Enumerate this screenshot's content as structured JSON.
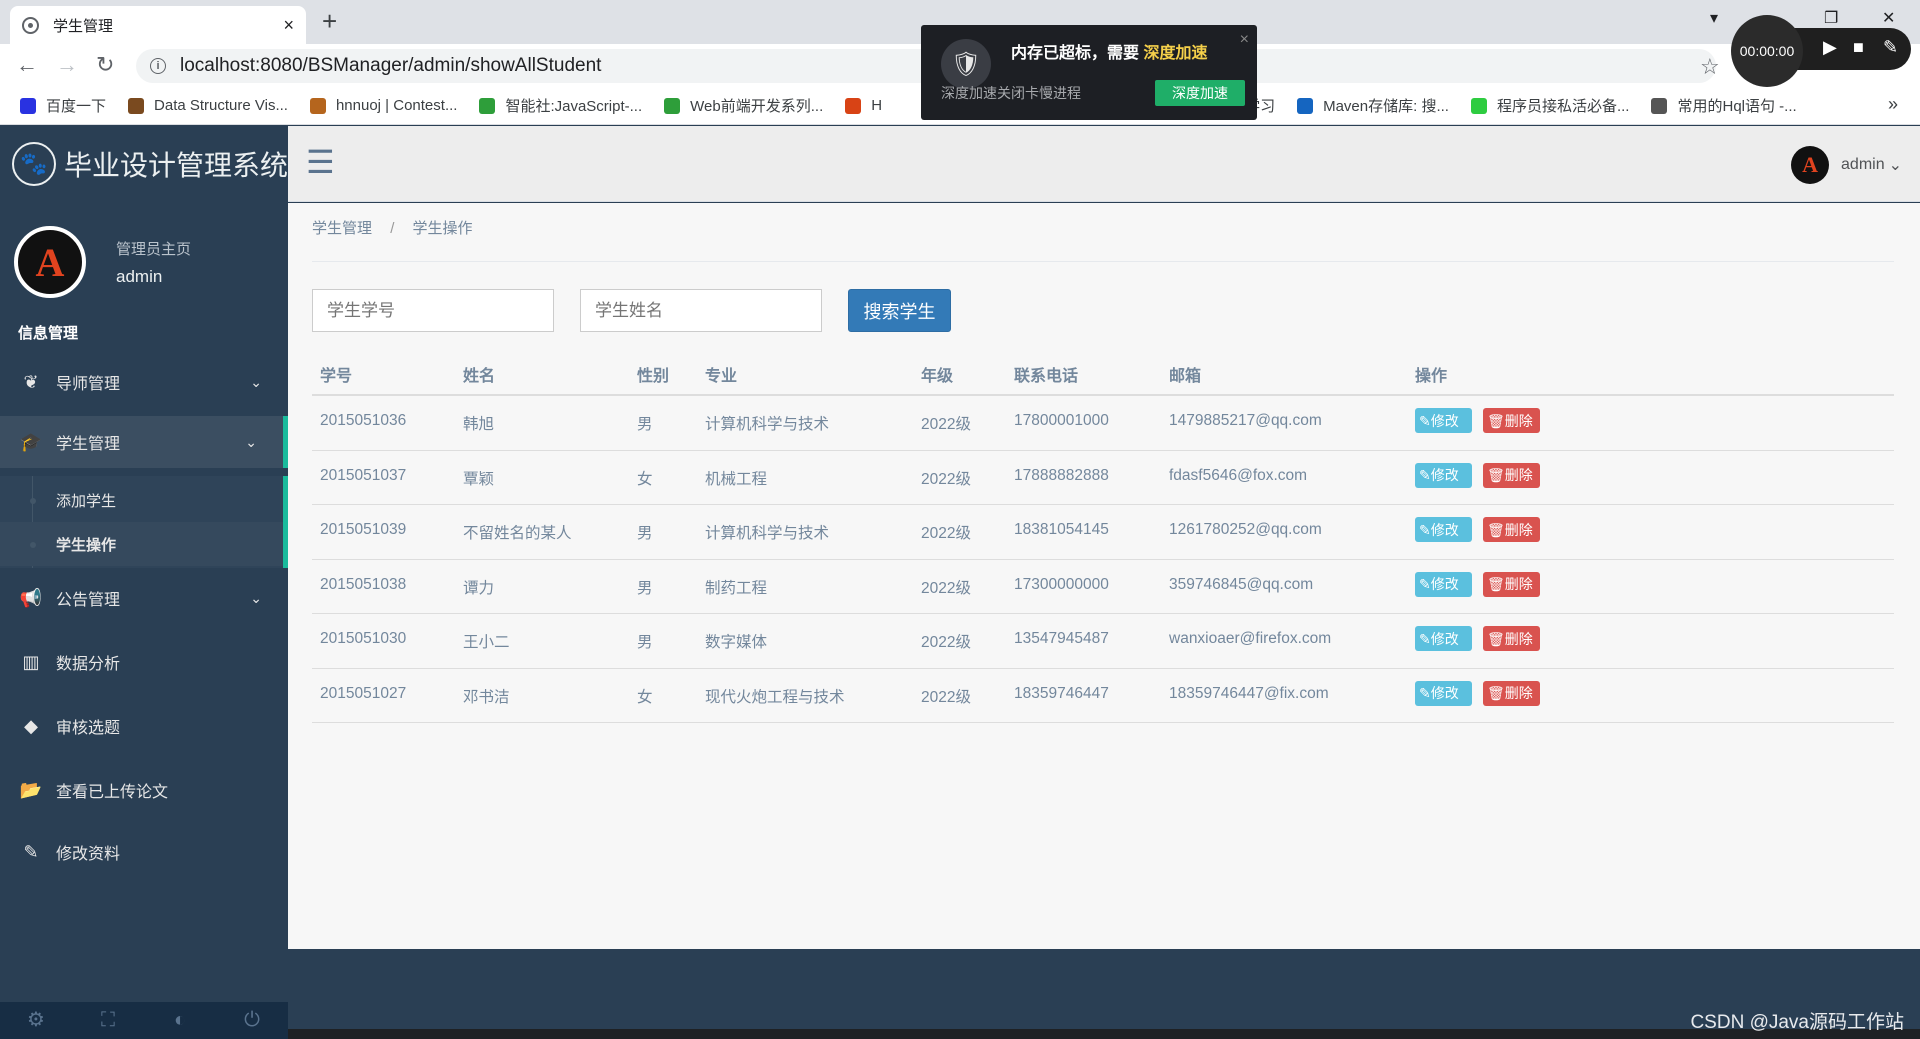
{
  "browser": {
    "tab_title": "学生管理",
    "tab_close": "×",
    "new_tab": "+",
    "url": "localhost:8080/BSManager/admin/showAllStudent",
    "bookmarks": [
      {
        "label": "百度一下",
        "color": "#2932e1"
      },
      {
        "label": "Data Structure Vis...",
        "color": "#7a4a1f"
      },
      {
        "label": "hnnuoj | Contest...",
        "color": "#b5651d"
      },
      {
        "label": "智能社:JavaScript-...",
        "color": "#2e9e3a"
      },
      {
        "label": "Web前端开发系列...",
        "color": "#2e9e3a"
      },
      {
        "label": "H",
        "color": "#d84315"
      },
      {
        "label": "的学习",
        "color": "#ffffff"
      },
      {
        "label": "Maven存储库: 搜...",
        "color": "#1565c0"
      },
      {
        "label": "程序员接私活必备...",
        "color": "#2ecc40"
      },
      {
        "label": "常用的Hql语句 -...",
        "color": "#555555"
      }
    ],
    "more_bookmarks": "»"
  },
  "popup": {
    "message_prefix": "内存已超标，需要",
    "message_highlight": "深度加速",
    "sub": "深度加速关闭卡慢进程",
    "action": "深度加速",
    "close": "×"
  },
  "recorder": {
    "time": "00:00:00"
  },
  "app": {
    "brand": "毕业设计管理系统",
    "profile": {
      "welcome": "管理员主页",
      "name": "admin",
      "avatar_letter": "A"
    },
    "section_title": "信息管理",
    "menu": [
      {
        "label": "导师管理",
        "icon": "leaf-icon"
      },
      {
        "label": "学生管理",
        "icon": "graduation-cap-icon"
      },
      {
        "label": "公告管理",
        "icon": "bullhorn-icon"
      },
      {
        "label": "数据分析",
        "icon": "bar-chart-icon"
      },
      {
        "label": "审核选题",
        "icon": "tags-icon"
      },
      {
        "label": "查看已上传论文",
        "icon": "folder-open-icon"
      },
      {
        "label": "修改资料",
        "icon": "edit-icon"
      }
    ],
    "submenu": [
      {
        "label": "添加学生"
      },
      {
        "label": "学生操作"
      }
    ],
    "topnav": {
      "username": "admin",
      "caret": "⌄"
    },
    "breadcrumb": {
      "first": "学生管理",
      "separator": "/",
      "current": "学生操作"
    },
    "search": {
      "id_placeholder": "学生学号",
      "name_placeholder": "学生姓名",
      "button": "搜索学生"
    },
    "table": {
      "headers": [
        "学号",
        "姓名",
        "性别",
        "专业",
        "年级",
        "联系电话",
        "邮箱",
        "操作"
      ],
      "rows": [
        [
          "2015051036",
          "韩旭",
          "男",
          "计算机科学与技术",
          "2022级",
          "17800001000",
          "1479885217@qq.com"
        ],
        [
          "2015051037",
          "覃颖",
          "女",
          "机械工程",
          "2022级",
          "17888882888",
          "fdasf5646@fox.com"
        ],
        [
          "2015051039",
          "不留姓名的某人",
          "男",
          "计算机科学与技术",
          "2022级",
          "18381054145",
          "1261780252@qq.com"
        ],
        [
          "2015051038",
          "谭力",
          "男",
          "制药工程",
          "2022级",
          "17300000000",
          "359746845@qq.com"
        ],
        [
          "2015051030",
          "王小二",
          "男",
          "数字媒体",
          "2022级",
          "13547945487",
          "wanxioaer@firefox.com"
        ],
        [
          "2015051027",
          "邓书洁",
          "女",
          "现代火炮工程与技术",
          "2022级",
          "18359746447",
          "18359746447@fix.com"
        ]
      ],
      "edit_label": "✎修改",
      "delete_label": "🗑删除"
    },
    "watermark": "CSDN @Java源码工作站"
  },
  "colors": {
    "sidebar": "#2a3f54",
    "accent": "#1abb9c",
    "primary": "#337ab7",
    "info": "#5bc0de",
    "danger": "#d9534f"
  }
}
